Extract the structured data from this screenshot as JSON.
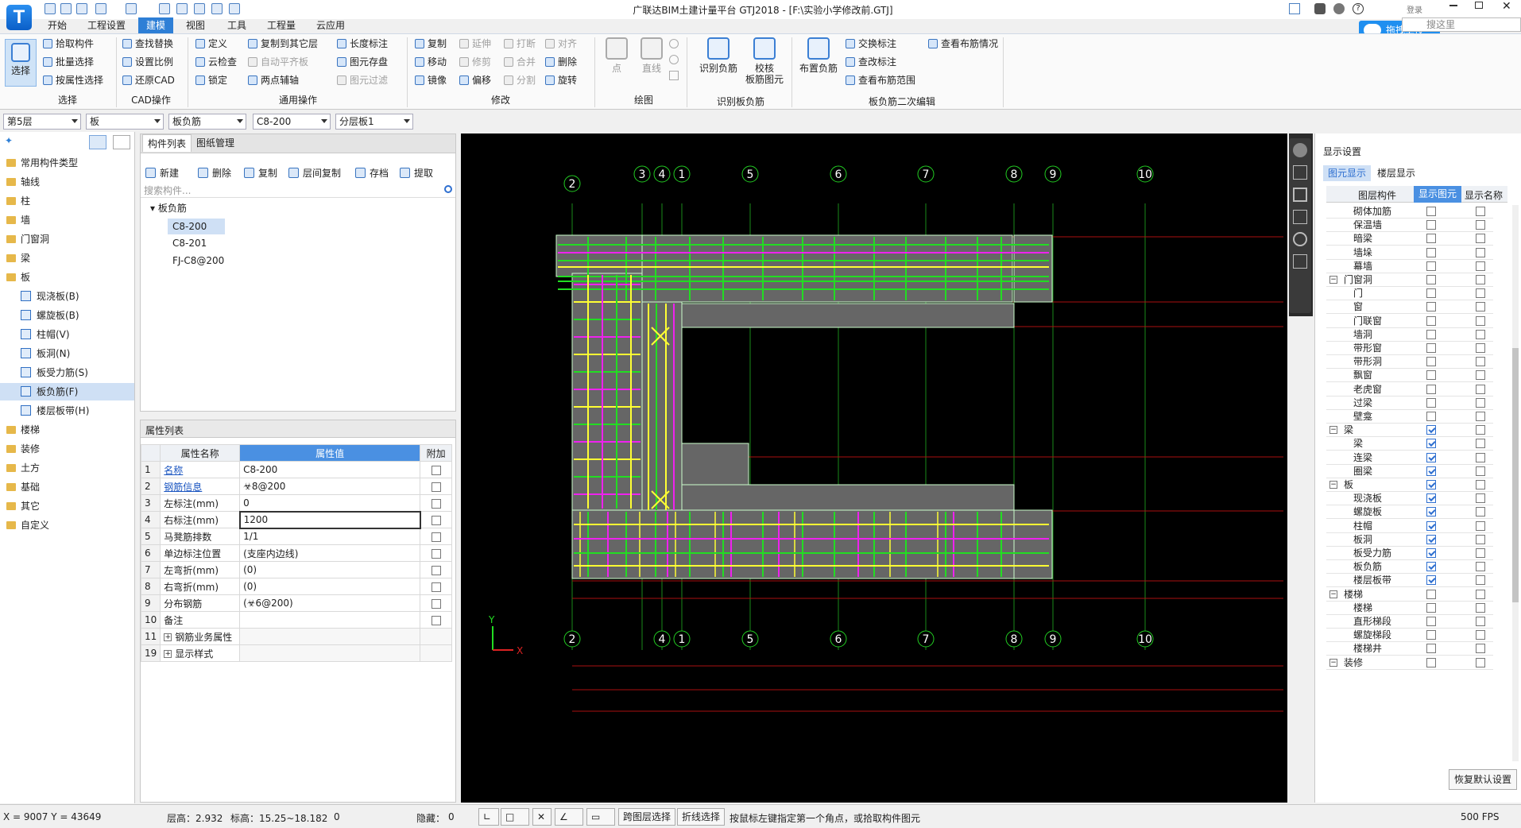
{
  "app": {
    "title": "广联达BIM土建计量平台 GTJ2018 - [F:\\实验小学修改前.GTJ]",
    "logo": "T",
    "upload_label": "拖拽上传",
    "search_placeholder": "搜这里",
    "sign_label": "登录"
  },
  "tabs": [
    "开始",
    "工程设置",
    "建模",
    "视图",
    "工具",
    "工程量",
    "云应用"
  ],
  "ribbon": {
    "select_big": "选择",
    "select_items": [
      "拾取构件",
      "批量选择",
      "按属性选择"
    ],
    "select_group": "选择",
    "cad_items": [
      "查找替换",
      "设置比例",
      "还原CAD"
    ],
    "cad_group": "CAD操作",
    "common_col1": [
      "定义",
      "云检查",
      "锁定"
    ],
    "common_col2": [
      "复制到其它层",
      "自动平齐板",
      "两点辅轴"
    ],
    "common_col3": [
      "长度标注",
      "图元存盘",
      "图元过滤"
    ],
    "common_group": "通用操作",
    "modify_col1": [
      "复制",
      "移动",
      "镜像"
    ],
    "modify_col2": [
      "延伸",
      "修剪",
      "偏移"
    ],
    "modify_col3": [
      "打断",
      "合并",
      "分割"
    ],
    "modify_col4": [
      "对齐",
      "删除",
      "旋转"
    ],
    "modify_group": "修改",
    "draw_point": "点",
    "draw_line": "直线",
    "draw_group": "绘图",
    "recog_btn1": "识别负筋",
    "recog_btn2": "校核\n板筋图元",
    "recog_group": "识别板负筋",
    "layout_btn": "布置负筋",
    "edit_col1": [
      "交换标注",
      "查改标注",
      "查看布筋范围"
    ],
    "edit_col2": [
      "查看布筋情况"
    ],
    "edit_group": "板负筋二次编辑"
  },
  "combos": [
    "第5层",
    "板",
    "板负筋",
    "C8-200",
    "分层板1"
  ],
  "nav": {
    "items": [
      "常用构件类型",
      "轴线",
      "柱",
      "墙",
      "门窗洞",
      "梁",
      "板",
      "现浇板(B)",
      "螺旋板(B)",
      "柱帽(V)",
      "板洞(N)",
      "板受力筋(S)",
      "板负筋(F)",
      "楼层板带(H)",
      "楼梯",
      "装修",
      "土方",
      "基础",
      "其它",
      "自定义"
    ]
  },
  "complist": {
    "tabs": [
      "构件列表",
      "图纸管理"
    ],
    "tools": [
      "新建",
      "删除",
      "复制",
      "层间复制",
      "存档",
      "提取"
    ],
    "search_placeholder": "搜索构件...",
    "root": "板负筋",
    "children": [
      "C8-200",
      "C8-201",
      "FJ-C8@200"
    ]
  },
  "props": {
    "title": "属性列表",
    "headers": [
      "属性名称",
      "属性值",
      "附加"
    ],
    "rows": [
      {
        "n": "1",
        "name": "名称",
        "val": "C8-200",
        "chk": false,
        "link": true
      },
      {
        "n": "2",
        "name": "钢筋信息",
        "val": "☣8@200",
        "chk": true,
        "link": true
      },
      {
        "n": "3",
        "name": "左标注(mm)",
        "val": "0",
        "chk": true,
        "link": false
      },
      {
        "n": "4",
        "name": "右标注(mm)",
        "val": "1200",
        "chk": true,
        "link": false
      },
      {
        "n": "5",
        "name": "马凳筋排数",
        "val": "1/1",
        "chk": true,
        "link": false
      },
      {
        "n": "6",
        "name": "单边标注位置",
        "val": "(支座内边线)",
        "chk": true,
        "link": false
      },
      {
        "n": "7",
        "name": "左弯折(mm)",
        "val": "(0)",
        "chk": true,
        "link": false
      },
      {
        "n": "8",
        "name": "右弯折(mm)",
        "val": "(0)",
        "chk": true,
        "link": false
      },
      {
        "n": "9",
        "name": "分布钢筋",
        "val": "(☣6@200)",
        "chk": true,
        "link": false
      },
      {
        "n": "10",
        "name": "备注",
        "val": "",
        "chk": true,
        "link": false
      },
      {
        "n": "11",
        "name": "钢筋业务属性",
        "val": "",
        "chk": null,
        "link": false
      },
      {
        "n": "19",
        "name": "显示样式",
        "val": "",
        "chk": null,
        "link": false
      }
    ]
  },
  "canvas": {
    "axis_top": [
      "2",
      "3",
      "4",
      "1",
      "5",
      "6",
      "7",
      "8",
      "9",
      "10"
    ],
    "axis_bottom": [
      "2",
      "4",
      "1",
      "5",
      "6",
      "7",
      "8",
      "9",
      "10"
    ],
    "ucs_x": "X",
    "ucs_y": "Y"
  },
  "display": {
    "title": "显示设置",
    "tabs": [
      "图元显示",
      "楼层显示"
    ],
    "headers": [
      "图层构件",
      "显示图元",
      "显示名称"
    ],
    "rows": [
      {
        "name": "砌体加筋",
        "a": false,
        "b": false,
        "g": false
      },
      {
        "name": "保温墙",
        "a": false,
        "b": false,
        "g": false
      },
      {
        "name": "暗梁",
        "a": false,
        "b": false,
        "g": false
      },
      {
        "name": "墙垛",
        "a": false,
        "b": false,
        "g": false
      },
      {
        "name": "幕墙",
        "a": false,
        "b": false,
        "g": false
      },
      {
        "name": "门窗洞",
        "a": false,
        "b": false,
        "g": true
      },
      {
        "name": "门",
        "a": false,
        "b": false,
        "g": false
      },
      {
        "name": "窗",
        "a": false,
        "b": false,
        "g": false
      },
      {
        "name": "门联窗",
        "a": false,
        "b": false,
        "g": false
      },
      {
        "name": "墙洞",
        "a": false,
        "b": false,
        "g": false
      },
      {
        "name": "带形窗",
        "a": false,
        "b": false,
        "g": false
      },
      {
        "name": "带形洞",
        "a": false,
        "b": false,
        "g": false
      },
      {
        "name": "飘窗",
        "a": false,
        "b": false,
        "g": false
      },
      {
        "name": "老虎窗",
        "a": false,
        "b": false,
        "g": false
      },
      {
        "name": "过梁",
        "a": false,
        "b": false,
        "g": false
      },
      {
        "name": "壁龛",
        "a": false,
        "b": false,
        "g": false
      },
      {
        "name": "梁",
        "a": true,
        "b": false,
        "g": true
      },
      {
        "name": "梁",
        "a": true,
        "b": false,
        "g": false
      },
      {
        "name": "连梁",
        "a": true,
        "b": false,
        "g": false
      },
      {
        "name": "圈梁",
        "a": true,
        "b": false,
        "g": false
      },
      {
        "name": "板",
        "a": true,
        "b": false,
        "g": true
      },
      {
        "name": "现浇板",
        "a": true,
        "b": false,
        "g": false
      },
      {
        "name": "螺旋板",
        "a": true,
        "b": false,
        "g": false
      },
      {
        "name": "柱帽",
        "a": true,
        "b": false,
        "g": false
      },
      {
        "name": "板洞",
        "a": true,
        "b": false,
        "g": false
      },
      {
        "name": "板受力筋",
        "a": true,
        "b": false,
        "g": false
      },
      {
        "name": "板负筋",
        "a": true,
        "b": false,
        "g": false
      },
      {
        "name": "楼层板带",
        "a": true,
        "b": false,
        "g": false
      },
      {
        "name": "楼梯",
        "a": false,
        "b": false,
        "g": true
      },
      {
        "name": "楼梯",
        "a": false,
        "b": false,
        "g": false
      },
      {
        "name": "直形梯段",
        "a": false,
        "b": false,
        "g": false
      },
      {
        "name": "螺旋梯段",
        "a": false,
        "b": false,
        "g": false
      },
      {
        "name": "楼梯井",
        "a": false,
        "b": false,
        "g": false
      },
      {
        "name": "装修",
        "a": false,
        "b": false,
        "g": true
      }
    ],
    "restore": "恢复默认设置"
  },
  "status": {
    "coords": "X = 9007 Y = 43649",
    "floor_height": "层高：2.932",
    "elevation": "标高：15.25~18.182",
    "count": "0",
    "hidden": "隐藏：",
    "hidden_count": "0",
    "btn_cross": "跨图层选择",
    "btn_polyline": "折线选择",
    "hint": "按鼠标左键指定第一个角点，或拾取构件图元",
    "fps": "500 FPS"
  },
  "colors": {
    "accent": "#2e7fd6",
    "slab": "#666666",
    "green": "#22dd22",
    "magenta": "#ee22ee",
    "yellow": "#ffff33",
    "axis": "#aa1111"
  }
}
